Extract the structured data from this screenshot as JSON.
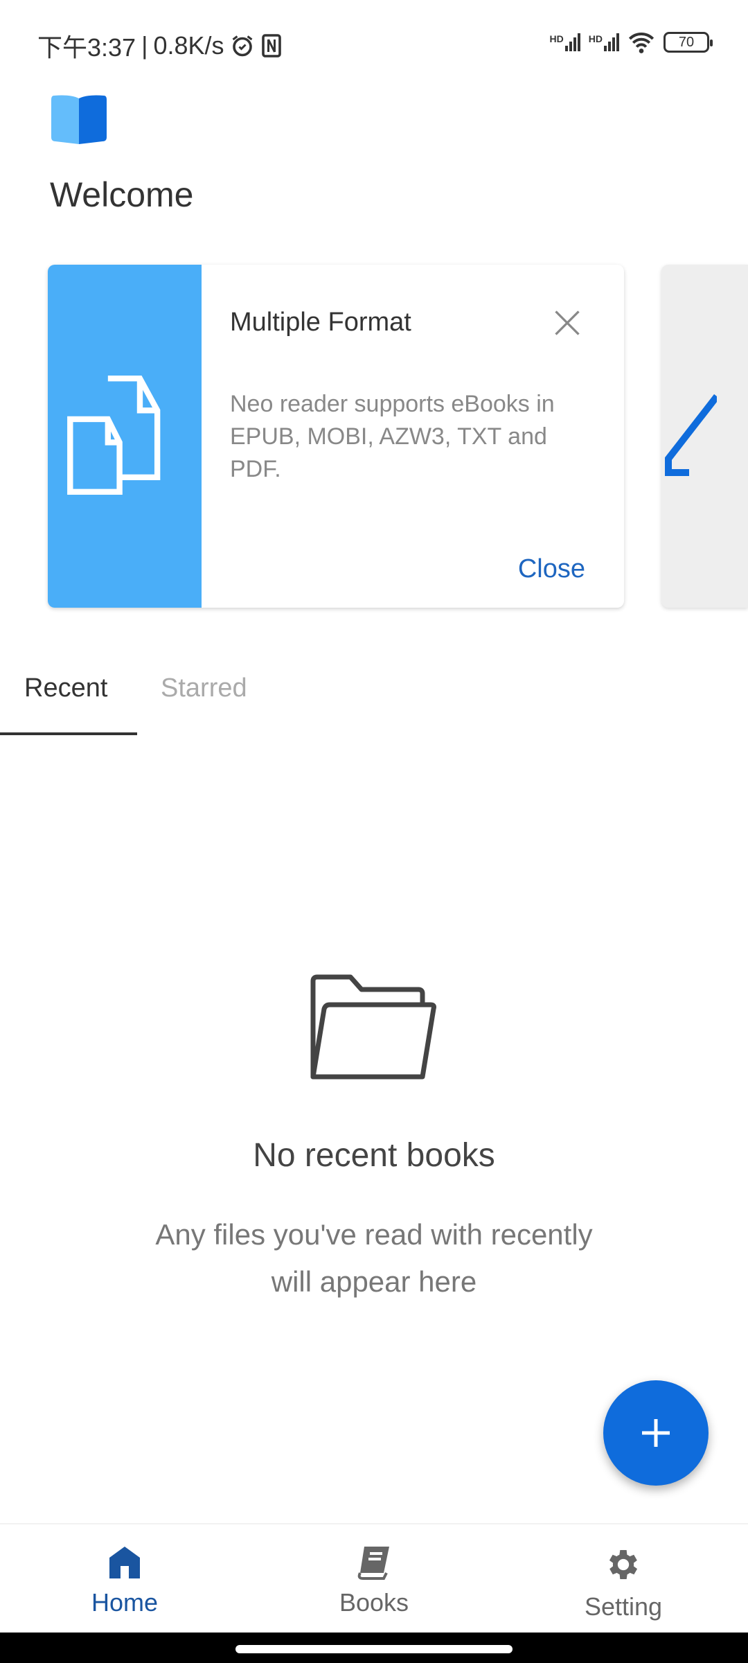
{
  "status_bar": {
    "time": "下午3:37",
    "net_speed": "0.8K/s",
    "battery": "70",
    "signal1": "HD",
    "signal2": "HD"
  },
  "header": {
    "title": "Welcome"
  },
  "tip_card": {
    "title": "Multiple Format",
    "description": "Neo reader supports eBooks in EPUB, MOBI, AZW3, TXT and PDF.",
    "close_label": "Close"
  },
  "tabs": [
    {
      "label": "Recent",
      "active": true
    },
    {
      "label": "Starred",
      "active": false
    }
  ],
  "empty_state": {
    "title": "No recent books",
    "subtitle_line1": "Any files you've read with recently",
    "subtitle_line2": "will appear here"
  },
  "bottom_nav": [
    {
      "label": "Home",
      "icon": "home-icon",
      "active": true
    },
    {
      "label": "Books",
      "icon": "book-icon",
      "active": false
    },
    {
      "label": "Setting",
      "icon": "gear-icon",
      "active": false
    }
  ],
  "colors": {
    "accent": "#0f6cdc",
    "card_blue": "#4aaef8",
    "nav_active": "#1a55a0"
  }
}
